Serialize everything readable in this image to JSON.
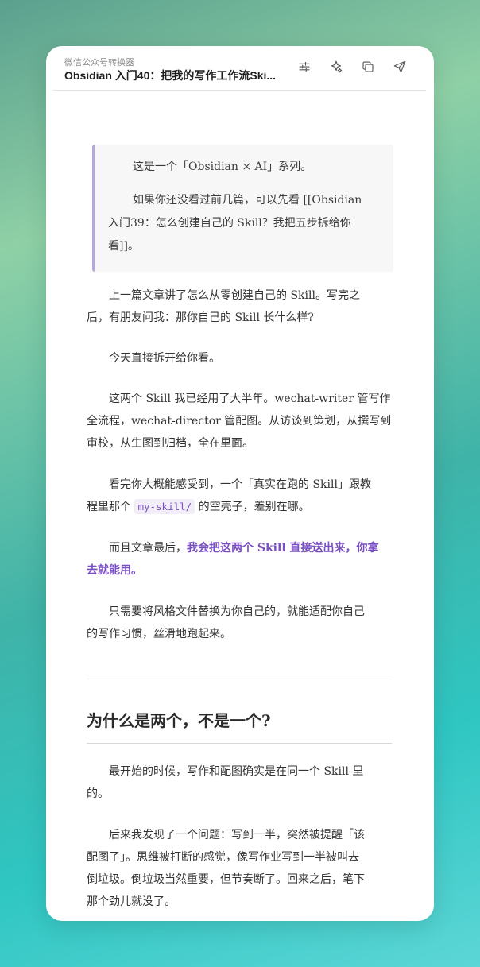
{
  "app": {
    "name": "微信公众号转换器",
    "document_title": "Obsidian 入门40：把我的写作工作流Ski..."
  },
  "toolbar": {
    "icons": [
      "sliders-icon",
      "sparkles-icon",
      "copy-icon",
      "send-icon"
    ]
  },
  "article": {
    "quote": {
      "line1": "这是一个「Obsidian × AI」系列。",
      "line2": "如果你还没看过前几篇，可以先看 [[Obsidian",
      "line3": "入门39：怎么创建自己的 Skill？我把五步拆给你",
      "line4": "看]]。"
    },
    "p1": {
      "l1": "上一篇文章讲了怎么从零创建自己的 Skill。写完之",
      "l2": "后，有朋友问我：那你自己的 Skill 长什么样?"
    },
    "p2": {
      "l1": "今天直接拆开给你看。"
    },
    "p3": {
      "l1": "这两个 Skill 我已经用了大半年。wechat-writer 管写作",
      "l2": "全流程，wechat-director 管配图。从访谈到策划，从撰写到",
      "l3": "审校，从生图到归档，全在里面。"
    },
    "p4": {
      "l1": "看完你大概能感受到，一个「真实在跑的 Skill」跟教",
      "l2_pre": "程里那个",
      "code": "my-skill/",
      "l2_post": "的空壳子，差别在哪。"
    },
    "p5": {
      "l1_pre": "而且文章最后，",
      "l1_accent": "我会把这两个 Skill 直接送出来，你拿",
      "l2_accent": "去就能用。"
    },
    "p6": {
      "l1": "只需要将风格文件替换为你自己的，就能适配你自己",
      "l2": "的写作习惯，丝滑地跑起来。"
    },
    "heading": "为什么是两个，不是一个?",
    "p7": {
      "l1": "最开始的时候，写作和配图确实是在同一个 Skill 里",
      "l2": "的。"
    },
    "p8": {
      "l1": "后来我发现了一个问题：写到一半，突然被提醒「该",
      "l2": "配图了」。思维被打断的感觉，像写作业写到一半被叫去",
      "l3": "倒垃圾。倒垃圾当然重要，但节奏断了。回来之后，笔下",
      "l4": "那个劲儿就没了。"
    }
  },
  "colors": {
    "accent": "#7a4fc4",
    "quote_border": "#b7a7dc"
  }
}
